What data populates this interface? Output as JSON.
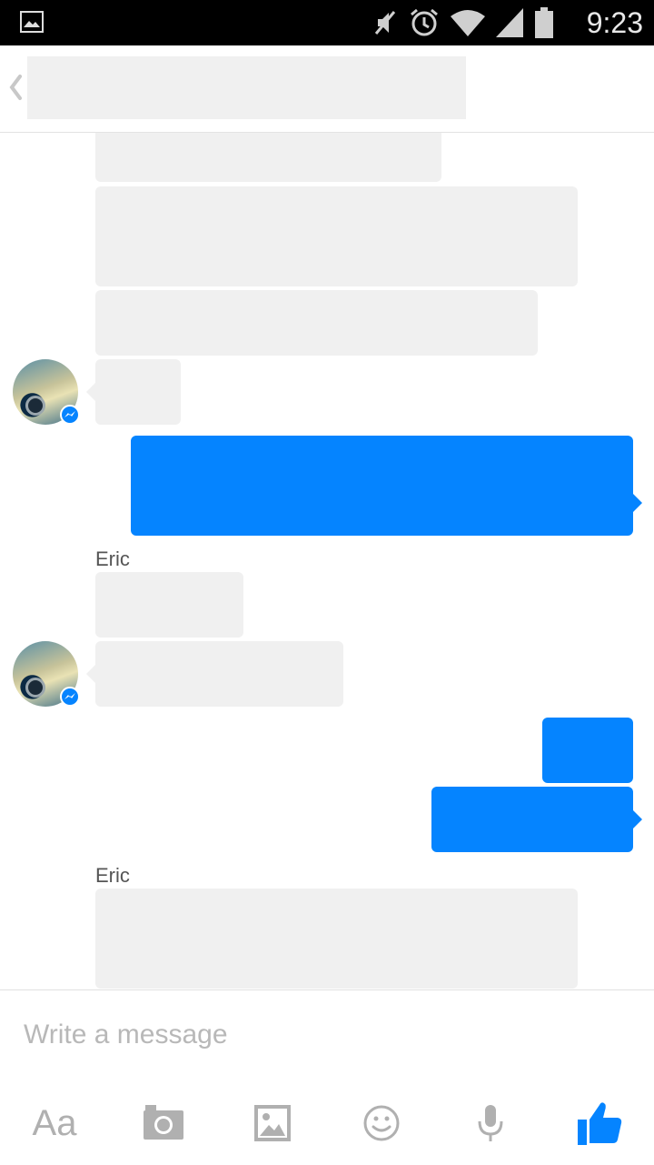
{
  "status_bar": {
    "time": "9:23",
    "icons": [
      "image-icon",
      "mute-icon",
      "alarm-icon",
      "wifi-icon",
      "signal-icon",
      "battery-icon"
    ]
  },
  "header": {
    "back_icon": "chevron-left-icon"
  },
  "conversation": {
    "sender_labels": [
      "Eric",
      "Eric"
    ]
  },
  "composer": {
    "placeholder": "Write a message",
    "value": "",
    "tools": {
      "text_style_label": "Aa",
      "icons": [
        "camera-icon",
        "gallery-icon",
        "emoji-icon",
        "microphone-icon",
        "like-icon"
      ]
    }
  },
  "colors": {
    "outgoing_bubble": "#0584ff",
    "incoming_bubble": "#f0f0f0",
    "toolbar_icon": "#b0b0b0",
    "like_icon": "#0584ff"
  }
}
